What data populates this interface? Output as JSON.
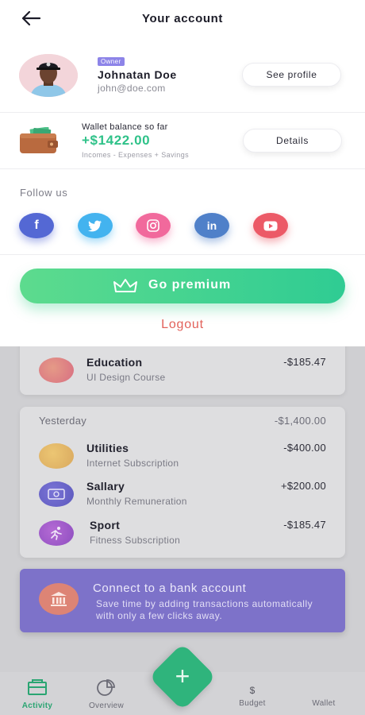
{
  "header": {
    "title": "Your account"
  },
  "profile": {
    "badge": "Owner",
    "name": "Johnatan Doe",
    "email": "john@doe.com",
    "see_profile_label": "See profile"
  },
  "wallet": {
    "label": "Wallet balance so far",
    "amount": "+$1422.00",
    "note": "Incomes - Expenses + Savings",
    "details_label": "Details"
  },
  "social": {
    "label": "Follow us",
    "networks": [
      "facebook",
      "twitter",
      "instagram",
      "linkedin",
      "youtube"
    ]
  },
  "premium": {
    "label": "Go premium"
  },
  "logout": {
    "label": "Logout"
  },
  "transactions": {
    "partial": {
      "title": "Education",
      "subtitle": "UI Design Course",
      "amount": "-$185.47",
      "color": "#e27a87"
    },
    "yesterday": {
      "label": "Yesterday",
      "total": "-$1,400.00",
      "items": [
        {
          "title": "Utilities",
          "subtitle": "Internet Subscription",
          "amount": "-$400.00",
          "color": "#e7b86a"
        },
        {
          "title": "Sallary",
          "subtitle": "Monthly Remuneration",
          "amount": "+$200.00",
          "color": "#6866c9"
        },
        {
          "title": "Sport",
          "subtitle": "Fitness Subscription",
          "amount": "-$185.47",
          "color": "#a65bc9"
        }
      ]
    }
  },
  "bank": {
    "title": "Connect to a bank account",
    "description": "Save time by adding transactions automatically with only a few clicks away."
  },
  "nav": {
    "activity": "Activity",
    "overview": "Overview",
    "budget": "Budget",
    "budget_symbol": "$",
    "wallet": "Wallet",
    "fab": "+"
  },
  "colors": {
    "accent_green": "#2fc289",
    "logout_red": "#e2615a",
    "owner_badge": "#8d84e8",
    "bank_card": "#7d72c9"
  }
}
